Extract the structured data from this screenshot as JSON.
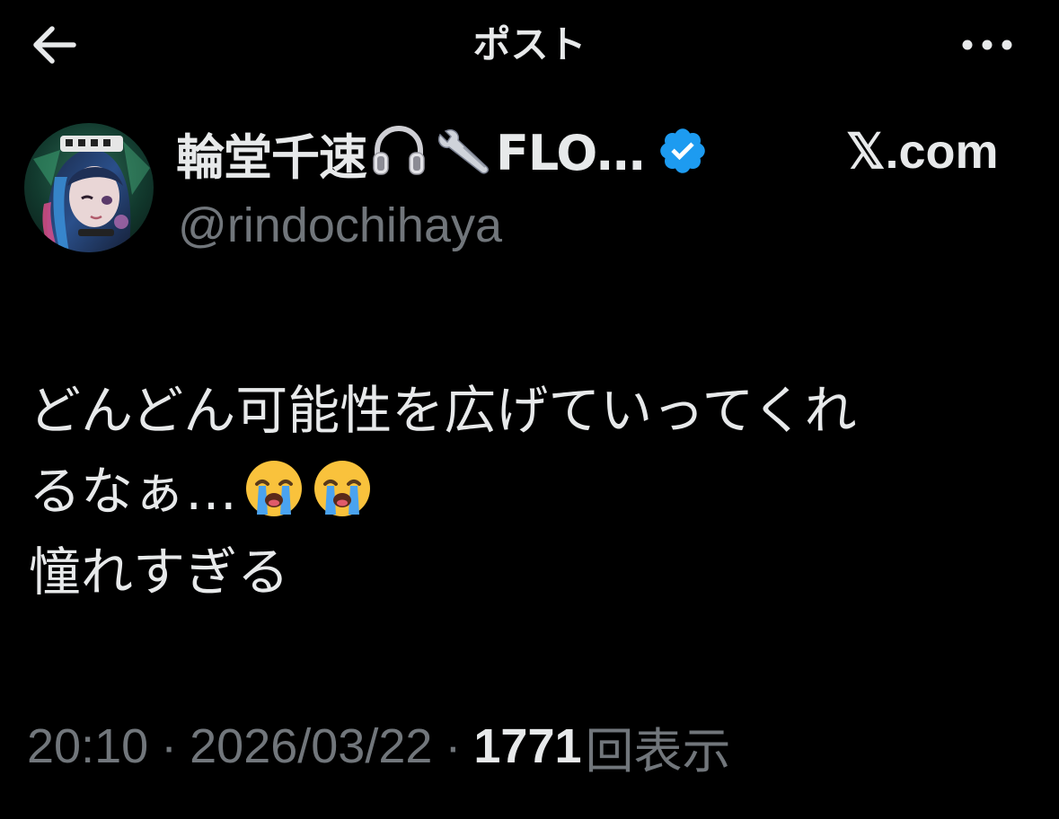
{
  "header": {
    "title": "ポスト",
    "back_icon": "arrow-left-icon",
    "more_icon": "more-horizontal-icon"
  },
  "author": {
    "display_name": "輪堂千速",
    "name_truncated": "FLO…",
    "name_icons": [
      "headphones-icon",
      "wrench-icon"
    ],
    "verified_icon": "verified-badge-icon",
    "handle": "@rindochihaya",
    "avatar_icon": "avatar-image"
  },
  "source_link": "𝕏.com",
  "tweet": {
    "lines": [
      "どんどん可能性を広げていってくれ",
      "るなぁ…",
      "憧れすぎる"
    ],
    "emoji": [
      "loudly-crying-face-icon",
      "loudly-crying-face-icon"
    ]
  },
  "meta": {
    "time": "20:10",
    "separator": "·",
    "date": "2026/03/22",
    "views_count": "1771",
    "views_label": "回表示"
  },
  "colors": {
    "background": "#000000",
    "text_primary": "#e7e9ea",
    "text_secondary": "#71767b",
    "verified": "#1d9bf0"
  }
}
